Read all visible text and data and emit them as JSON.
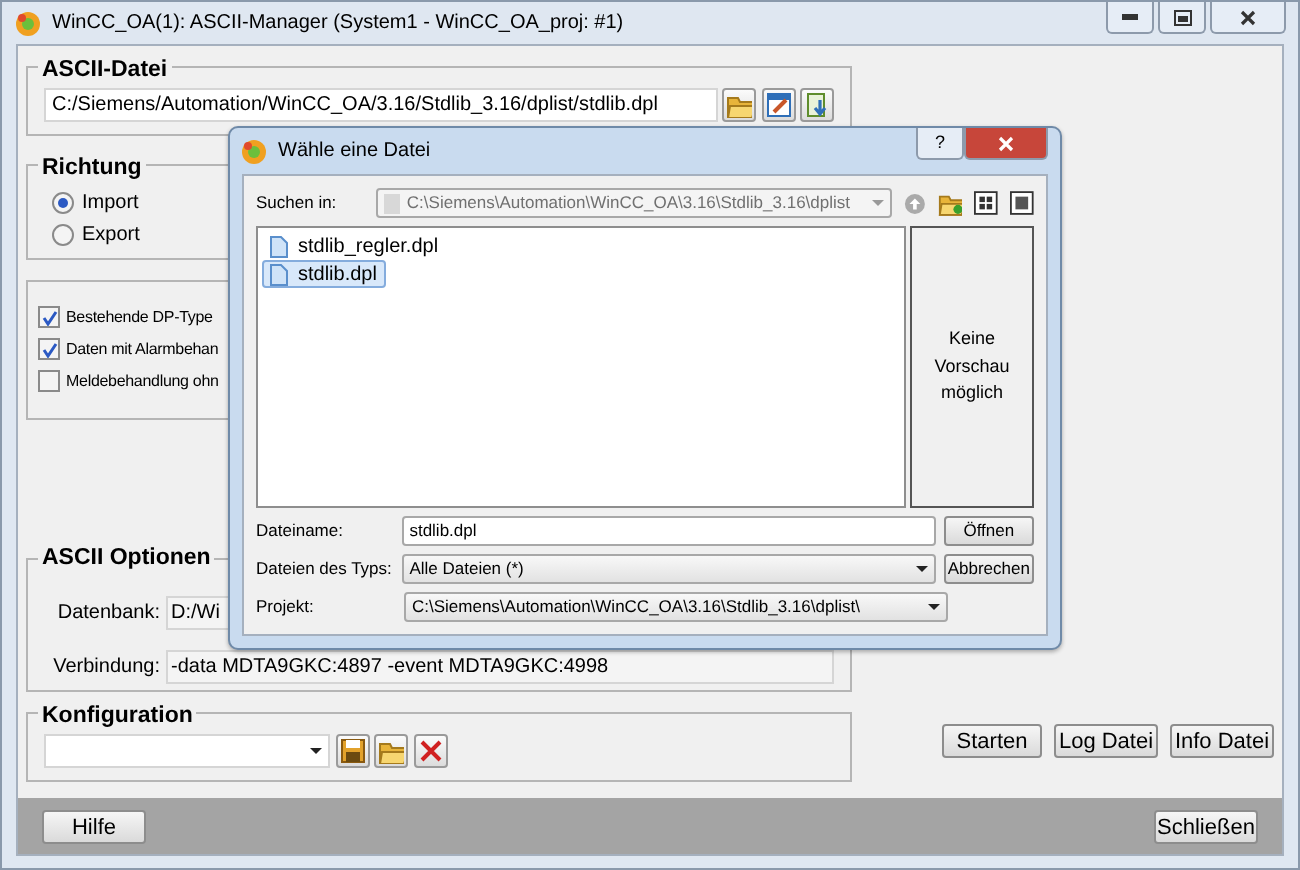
{
  "window": {
    "title": "WinCC_OA(1): ASCII-Manager (System1 - WinCC_OA_proj: #1)"
  },
  "ascii_file": {
    "label": "ASCII-Datei",
    "value": "C:/Siemens/Automation/WinCC_OA/3.16/Stdlib_3.16/dplist/stdlib.dpl"
  },
  "direction": {
    "label": "Richtung",
    "options": [
      {
        "label": "Import",
        "selected": true
      },
      {
        "label": "Export",
        "selected": false
      }
    ]
  },
  "options": [
    {
      "label": "Bestehende DP-Type",
      "checked": true
    },
    {
      "label": "Daten mit Alarmbehan",
      "checked": true
    },
    {
      "label": "Meldebehandlung ohn",
      "checked": false
    }
  ],
  "ascii_options": {
    "label": "ASCII Optionen",
    "fields": [
      {
        "label": "Datenbank:",
        "value": "D:/Wi"
      },
      {
        "label": "Verbindung:",
        "value": "-data MDTA9GKC:4897 -event MDTA9GKC:4998"
      }
    ]
  },
  "configuration": {
    "label": "Konfiguration"
  },
  "actions": [
    "Starten",
    "Log Datei",
    "Info Datei"
  ],
  "footer": {
    "buttons": [
      "Hilfe",
      "Schließen"
    ]
  },
  "dialog": {
    "title": "Wähle eine Datei",
    "help": "?",
    "look_in": {
      "label": "Suchen in:",
      "value": "C:\\Siemens\\Automation\\WinCC_OA\\3.16\\Stdlib_3.16\\dplist"
    },
    "files": [
      {
        "name": "stdlib_regler.dpl",
        "selected": false
      },
      {
        "name": "stdlib.dpl",
        "selected": true
      }
    ],
    "preview": "Keine Vorschau möglich",
    "file_name": {
      "label": "Dateiname:",
      "value": "stdlib.dpl"
    },
    "file_type": {
      "label": "Dateien des Typs:",
      "value": "Alle Dateien (*)"
    },
    "project": {
      "label": "Projekt:",
      "value": "C:\\Siemens\\Automation\\WinCC_OA\\3.16\\Stdlib_3.16\\dplist\\"
    },
    "buttons": [
      "Öffnen",
      "Abbrechen"
    ]
  }
}
